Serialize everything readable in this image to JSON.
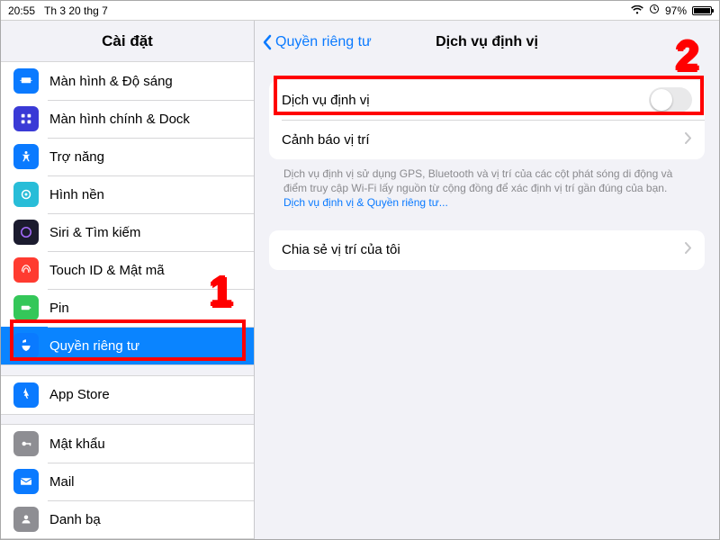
{
  "statusbar": {
    "time": "20:55",
    "date": "Th 3 20 thg 7",
    "battery_percent": "97%"
  },
  "sidebar": {
    "title": "Cài đặt",
    "items": {
      "display": "Màn hình & Độ sáng",
      "home_dock": "Màn hình chính & Dock",
      "accessibility": "Trợ năng",
      "wallpaper": "Hình nền",
      "siri": "Siri & Tìm kiếm",
      "touchid": "Touch ID & Mật mã",
      "battery": "Pin",
      "privacy": "Quyền riêng tư",
      "appstore": "App Store",
      "passwords": "Mật khẩu",
      "mail": "Mail",
      "contacts": "Danh bạ"
    }
  },
  "detail": {
    "back_label": "Quyền riêng tư",
    "title": "Dịch vụ định vị",
    "location_services_label": "Dịch vụ định vị",
    "location_alerts_label": "Cảnh báo vị trí",
    "footnote_text": "Dịch vụ định vị sử dụng GPS, Bluetooth và vị trí của các cột phát sóng di động và điểm truy cập Wi-Fi lấy nguồn từ cộng đồng để xác định vị trí gần đúng của bạn.",
    "footnote_link": "Dịch vụ định vị & Quyền riêng tư...",
    "share_location_label": "Chia sẻ vị trí của tôi"
  },
  "annotations": {
    "n1": "1",
    "n2": "2"
  }
}
